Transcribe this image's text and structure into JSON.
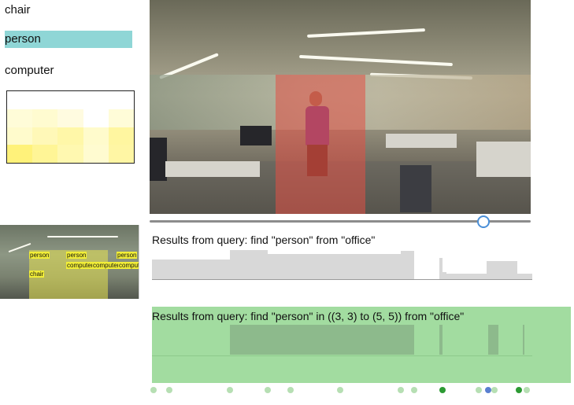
{
  "classes": {
    "items": [
      "chair",
      "person",
      "computer"
    ],
    "selected": "person"
  },
  "heatmap": {
    "rows": 4,
    "cols": 5,
    "colors": [
      [
        "#ffffff",
        "#ffffff",
        "#ffffff",
        "#ffffff",
        "#ffffff"
      ],
      [
        "#fffcd8",
        "#fffbd0",
        "#fffbe0",
        "#ffffff",
        "#fffcd8"
      ],
      [
        "#fffbcc",
        "#fff8b8",
        "#fff7a8",
        "#fffbcc",
        "#fff6a0"
      ],
      [
        "#fff27a",
        "#fff596",
        "#fff8b0",
        "#fffbd0",
        "#fff6a4"
      ]
    ]
  },
  "player": {
    "progress": 0.875
  },
  "thumbnail": {
    "tags": [
      "person",
      "person",
      "person",
      "computer",
      "computer",
      "computer",
      "chair"
    ]
  },
  "results": [
    {
      "title": "Results from query: find \"person\" from \"office\"",
      "segments": [
        {
          "start": 0.0,
          "end": 0.205,
          "level": 0.5
        },
        {
          "start": 0.205,
          "end": 0.305,
          "level": 1.0
        },
        {
          "start": 0.305,
          "end": 0.655,
          "level": 0.8
        },
        {
          "start": 0.655,
          "end": 0.69,
          "level": 0.95
        },
        {
          "start": 0.69,
          "end": 0.755,
          "level": 0.0
        },
        {
          "start": 0.755,
          "end": 0.765,
          "level": 0.6
        },
        {
          "start": 0.765,
          "end": 0.775,
          "level": 0.3
        },
        {
          "start": 0.775,
          "end": 0.88,
          "level": 0.2
        },
        {
          "start": 0.88,
          "end": 0.96,
          "level": 0.4
        },
        {
          "start": 0.96,
          "end": 1.0,
          "level": 0.2
        }
      ]
    },
    {
      "title": "Results from query: find \"person\" in ((3, 3) to (5, 5)) from \"office\"",
      "blocks": [
        {
          "start": 0.205,
          "end": 0.69
        },
        {
          "start": 0.755,
          "end": 0.765
        },
        {
          "start": 0.885,
          "end": 0.91
        },
        {
          "start": 0.975,
          "end": 0.98
        }
      ],
      "dots": [
        {
          "pos": 0.005,
          "kind": "light"
        },
        {
          "pos": 0.045,
          "kind": "light"
        },
        {
          "pos": 0.205,
          "kind": "light"
        },
        {
          "pos": 0.305,
          "kind": "light"
        },
        {
          "pos": 0.365,
          "kind": "light"
        },
        {
          "pos": 0.495,
          "kind": "light"
        },
        {
          "pos": 0.655,
          "kind": "light"
        },
        {
          "pos": 0.69,
          "kind": "light"
        },
        {
          "pos": 0.765,
          "kind": "dark"
        },
        {
          "pos": 0.86,
          "kind": "light"
        },
        {
          "pos": 0.885,
          "kind": "blue"
        },
        {
          "pos": 0.9,
          "kind": "light"
        },
        {
          "pos": 0.965,
          "kind": "dark"
        },
        {
          "pos": 0.985,
          "kind": "light"
        }
      ]
    }
  ]
}
